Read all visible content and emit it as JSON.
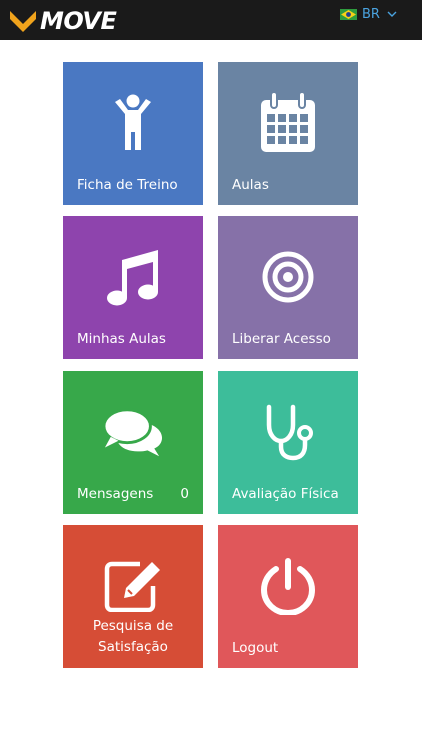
{
  "header": {
    "logo_text": "MOVE",
    "language": "BR",
    "flag_icon": "brazil-flag-icon"
  },
  "tiles": [
    {
      "label": "Ficha de Treino",
      "icon": "person-arms-up-icon",
      "color": "#4a78c2"
    },
    {
      "label": "Aulas",
      "icon": "calendar-icon",
      "color": "#6a84a3"
    },
    {
      "label": "Minhas Aulas",
      "icon": "music-note-icon",
      "color": "#8e44ad"
    },
    {
      "label": "Liberar Acesso",
      "icon": "target-icon",
      "color": "#8671a8"
    },
    {
      "label": "Mensagens",
      "count": "0",
      "icon": "chat-bubbles-icon",
      "color": "#37a84a"
    },
    {
      "label": "Avaliação Física",
      "icon": "stethoscope-icon",
      "color": "#3dbd9a"
    },
    {
      "label": "Pesquisa de Satisfação",
      "icon": "edit-icon",
      "color": "#d64d36"
    },
    {
      "label": "Logout",
      "icon": "power-icon",
      "color": "#e0575a"
    }
  ]
}
